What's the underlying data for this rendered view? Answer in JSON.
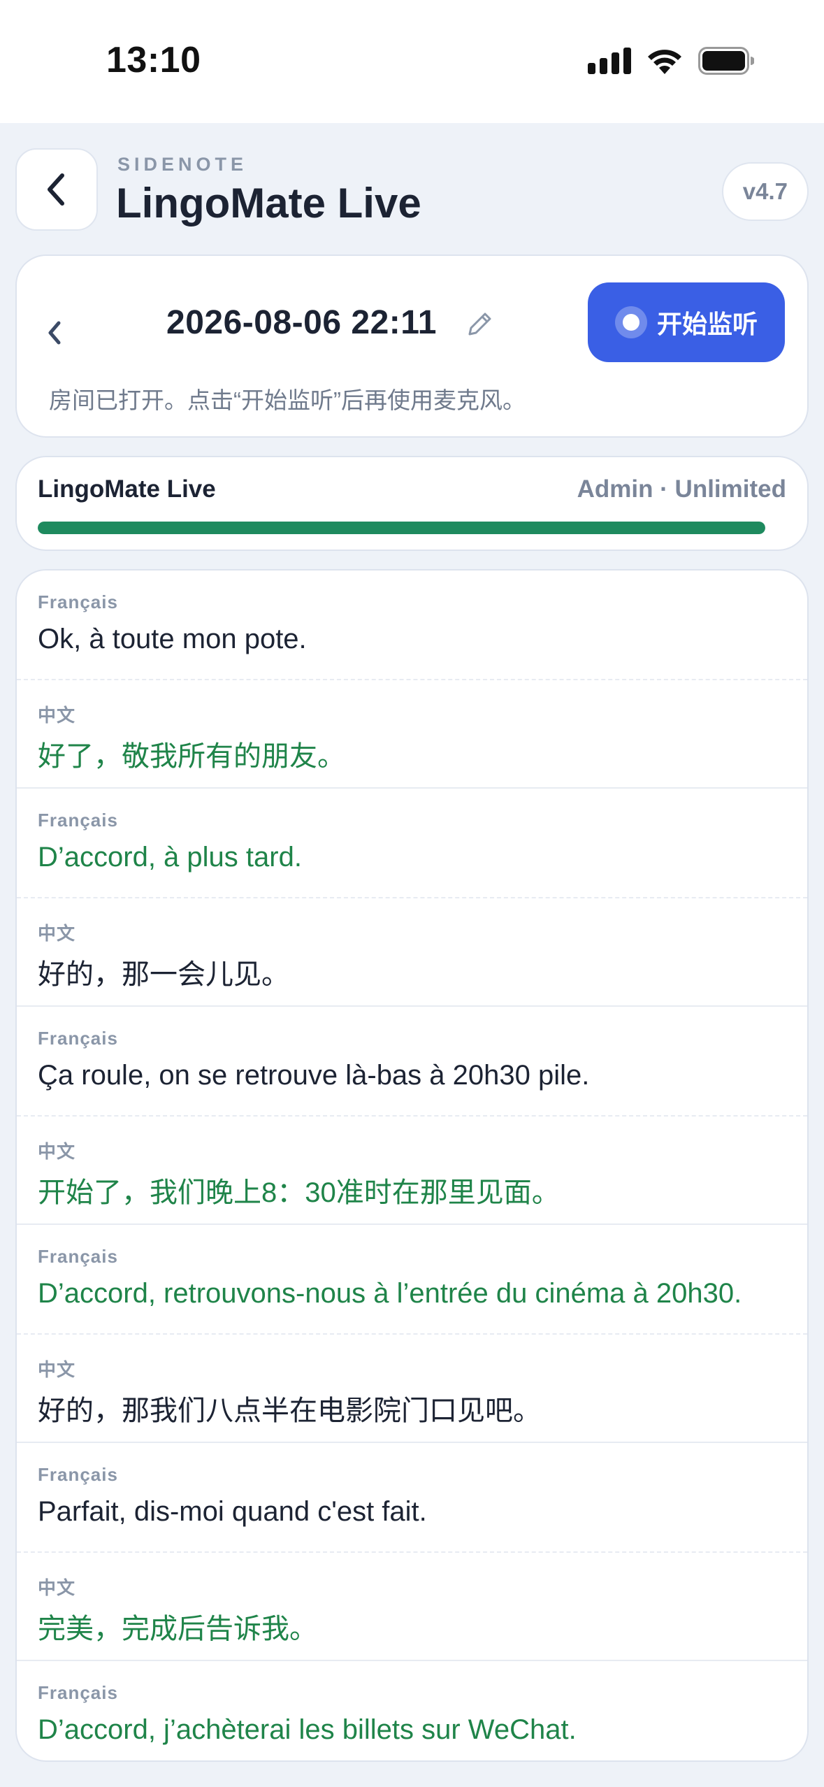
{
  "status_bar": {
    "time": "13:10",
    "icons": [
      "cellular-icon",
      "wifi-icon",
      "battery-icon"
    ]
  },
  "header": {
    "kicker": "SIDENOTE",
    "title": "LingoMate Live",
    "version": "v4.7",
    "back_icon": "chevron-left-icon"
  },
  "session": {
    "date_label": "2026-08-06 22:11",
    "listen_button": "开始监听",
    "hint": "房间已打开。点击“开始监听”后再使用麦克风。",
    "accent_color": "#3a5fe5"
  },
  "usage": {
    "name": "LingoMate Live",
    "plan": "Admin · Unlimited",
    "progress_fraction": 1.0,
    "bar_color": "#1e8a5e"
  },
  "transcript": [
    {
      "a": {
        "lang": "Français",
        "text": "Ok, à toute mon pote.",
        "highlight": false
      },
      "b": {
        "lang": "中文",
        "text": "好了，敬我所有的朋友。",
        "highlight": true
      }
    },
    {
      "a": {
        "lang": "Français",
        "text": "D’accord, à plus tard.",
        "highlight": true
      },
      "b": {
        "lang": "中文",
        "text": "好的，那一会儿见。",
        "highlight": false
      }
    },
    {
      "a": {
        "lang": "Français",
        "text": "Ça roule, on se retrouve là-bas à 20h30 pile.",
        "highlight": false
      },
      "b": {
        "lang": "中文",
        "text": "开始了，我们晚上8：30准时在那里见面。",
        "highlight": true
      }
    },
    {
      "a": {
        "lang": "Français",
        "text": "D’accord, retrouvons-nous à l’entrée du cinéma à 20h30.",
        "highlight": true
      },
      "b": {
        "lang": "中文",
        "text": "好的，那我们八点半在电影院门口见吧。",
        "highlight": false
      }
    },
    {
      "a": {
        "lang": "Français",
        "text": "Parfait, dis-moi quand c'est fait.",
        "highlight": false
      },
      "b": {
        "lang": "中文",
        "text": "完美，完成后告诉我。",
        "highlight": true
      }
    },
    {
      "a": {
        "lang": "Français",
        "text": "D’accord, j’achèterai les billets sur WeChat.",
        "highlight": true
      }
    }
  ],
  "colors": {
    "highlight_text": "#1f8449",
    "normal_text": "#1c2333"
  }
}
